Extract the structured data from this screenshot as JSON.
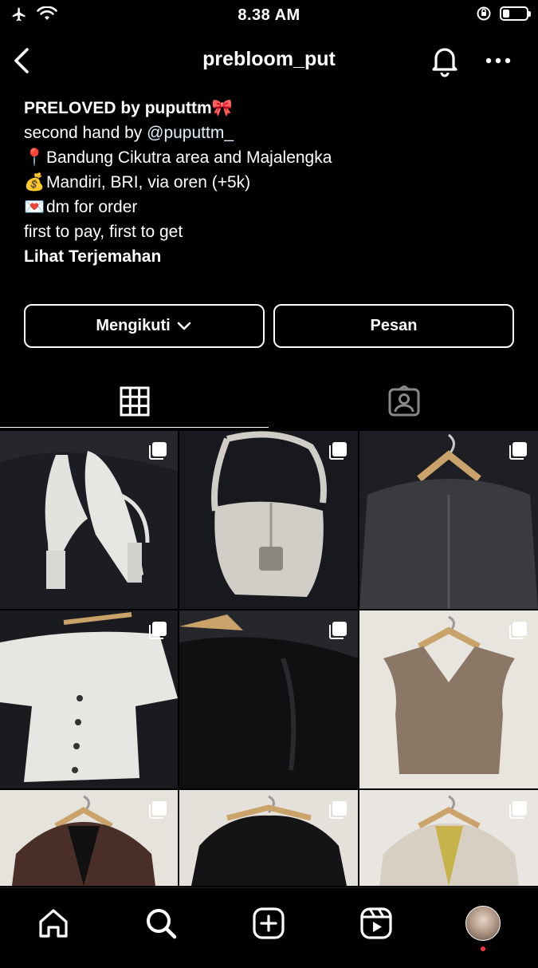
{
  "status_bar": {
    "time": "8.38 AM"
  },
  "header": {
    "title": "prebloom_put"
  },
  "bio": {
    "name": "PRELOVED by puputtm🎀",
    "lines": [
      {
        "icon": "",
        "text": "second hand by ",
        "link": "@puputtm_"
      },
      {
        "icon": "📍",
        "text": "Bandung Cikutra area and Majalengka"
      },
      {
        "icon": "💰",
        "text": "Mandiri, BRI, via oren (+5k)"
      },
      {
        "icon": "💌",
        "text": "dm for order"
      },
      {
        "icon": "",
        "text": "first to pay, first to get"
      }
    ],
    "translate": "Lihat Terjemahan"
  },
  "actions": {
    "follow_label": "Mengikuti",
    "message_label": "Pesan"
  },
  "tabs": [
    {
      "icon": "grid-icon"
    },
    {
      "icon": "tagged-icon"
    }
  ],
  "posts": [
    {
      "subject": "white slingback heels",
      "bg": "#1b1d22",
      "fg": "#e4e4e0"
    },
    {
      "subject": "grey saddle bag",
      "bg": "#17191e",
      "fg": "#cfcdc6"
    },
    {
      "subject": "dark fleece half-zip",
      "bg": "#1d1f24",
      "fg": "#3a3b3f"
    },
    {
      "subject": "white knit cardigan",
      "bg": "#1a1b1f",
      "fg": "#e6e6e3"
    },
    {
      "subject": "black ruched top",
      "bg": "#26272b",
      "fg": "#101012"
    },
    {
      "subject": "brown knit vest",
      "bg": "#e8e4de",
      "fg": "#8b7766"
    },
    {
      "subject": "brown leather jacket",
      "bg": "#e6e2dc",
      "fg": "#4a2f28"
    },
    {
      "subject": "black knit sweater",
      "bg": "#e4e0da",
      "fg": "#141416"
    },
    {
      "subject": "beige blazer",
      "bg": "#e9e6e1",
      "fg": "#d8cfc4"
    }
  ],
  "bottom_nav": [
    {
      "icon": "home-icon"
    },
    {
      "icon": "search-icon"
    },
    {
      "icon": "add-post-icon"
    },
    {
      "icon": "reels-icon"
    },
    {
      "icon": "profile-avatar"
    }
  ]
}
